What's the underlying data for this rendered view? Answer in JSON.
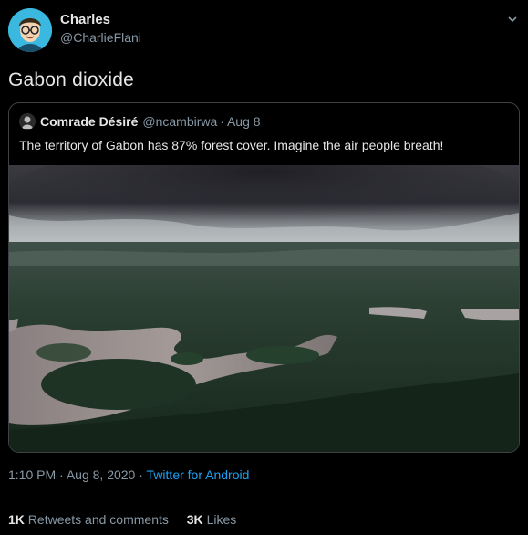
{
  "author": {
    "name": "Charles",
    "handle": "@CharlieFlani"
  },
  "tweet": {
    "text": "Gabon dioxide"
  },
  "quoted_tweet": {
    "name": "Comrade Désiré",
    "handle": "@ncambirwa",
    "separator": "·",
    "date": "Aug 8",
    "text": "The territory of Gabon has 87% forest cover. Imagine the air people breath!"
  },
  "meta": {
    "time": "1:10 PM",
    "separator_1": "·",
    "date": "Aug 8, 2020",
    "separator_2": "·",
    "source": "Twitter for Android"
  },
  "stats": {
    "retweets_count": "1K",
    "retweets_label": "Retweets and comments",
    "likes_count": "3K",
    "likes_label": "Likes"
  },
  "colors": {
    "background": "#000000",
    "link": "#1da1f2",
    "secondary_text": "#8899a6",
    "avatar_bg": "#3bb8e0"
  },
  "icons": {
    "caret": "chevron-down-icon"
  }
}
